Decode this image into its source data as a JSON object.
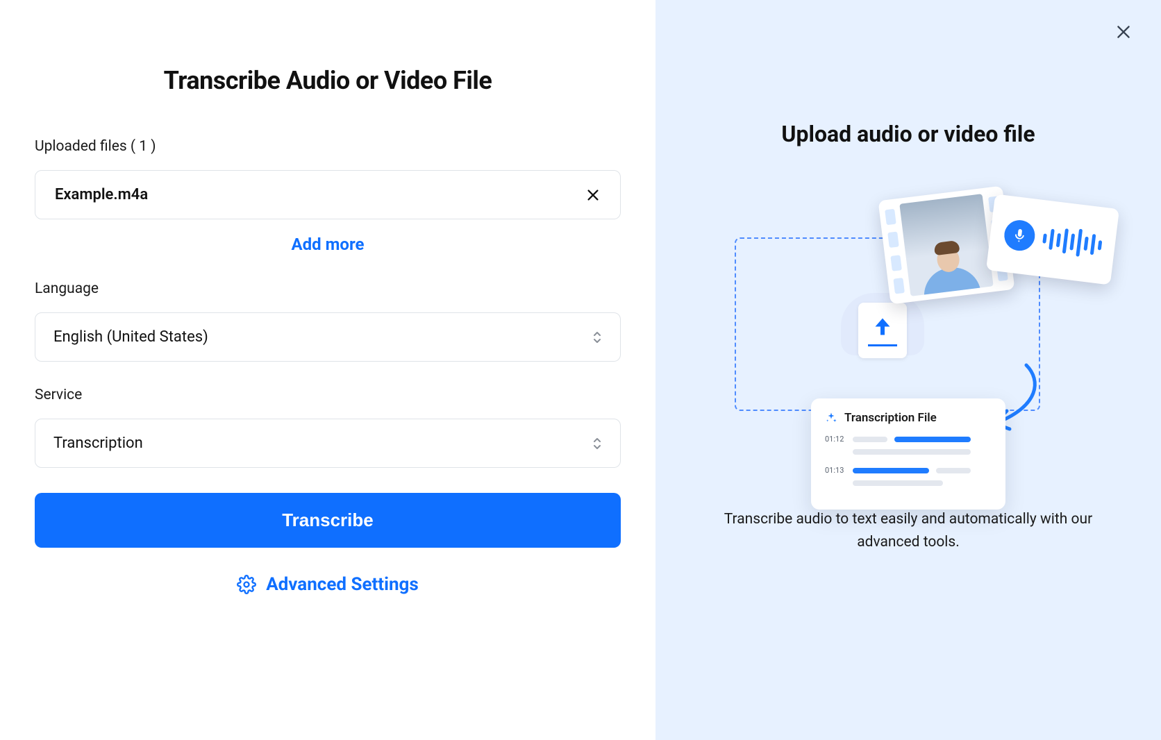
{
  "left": {
    "title": "Transcribe Audio or Video File",
    "uploadedLabelPrefix": "Uploaded files",
    "uploadedCount": "( 1 )",
    "fileName": "Example.m4a",
    "addMore": "Add more",
    "languageLabel": "Language",
    "languageValue": "English (United States)",
    "serviceLabel": "Service",
    "serviceValue": "Transcription",
    "primaryButton": "Transcribe",
    "advancedSettings": "Advanced Settings"
  },
  "right": {
    "title": "Upload audio or video file",
    "transCardTitle": "Transcription File",
    "ts1": "01:12",
    "ts2": "01:13",
    "blurb": "Transcribe audio to text easily and automatically with our advanced tools."
  }
}
